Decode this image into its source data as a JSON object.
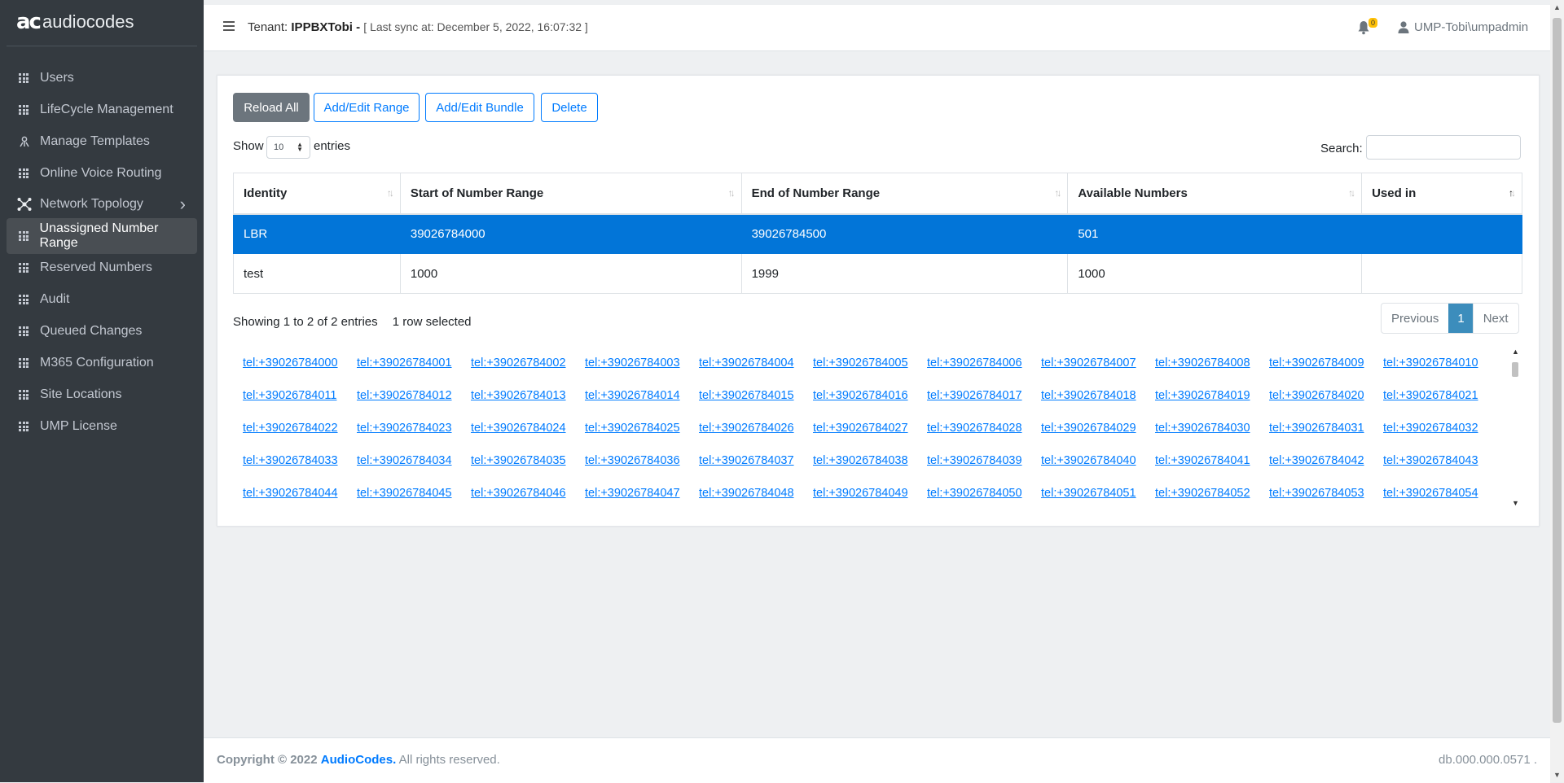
{
  "app": {
    "logo_mark": "ac",
    "logo_text": "audiocodes"
  },
  "sidebar": {
    "items": [
      {
        "label": "Users",
        "icon": "grid-icon"
      },
      {
        "label": "LifeCycle Management",
        "icon": "grid-icon"
      },
      {
        "label": "Manage Templates",
        "icon": "templates-icon"
      },
      {
        "label": "Online Voice Routing",
        "icon": "grid-icon"
      },
      {
        "label": "Network Topology",
        "icon": "network-icon"
      },
      {
        "label": "Unassigned Number Range",
        "icon": "grid-icon",
        "active": true
      },
      {
        "label": "Reserved Numbers",
        "icon": "grid-icon"
      },
      {
        "label": "Audit",
        "icon": "grid-icon"
      },
      {
        "label": "Queued Changes",
        "icon": "grid-icon"
      },
      {
        "label": "M365 Configuration",
        "icon": "grid-icon"
      },
      {
        "label": "Site Locations",
        "icon": "grid-icon"
      },
      {
        "label": "UMP License",
        "icon": "grid-icon"
      }
    ]
  },
  "header": {
    "tenant_prefix": "Tenant:",
    "tenant_name": "IPPBXTobi -",
    "sync": "[ Last sync at: December 5, 2022, 16:07:32 ]",
    "notification_count": "0",
    "user": "UMP-Tobi\\umpadmin"
  },
  "toolbar": {
    "reload_all": "Reload All",
    "add_edit_range": "Add/Edit Range",
    "add_edit_bundle": "Add/Edit Bundle",
    "delete": "Delete"
  },
  "table_controls": {
    "show": "Show",
    "page_length": "10",
    "entries": "entries",
    "search_label": "Search:",
    "search_value": ""
  },
  "table": {
    "columns": [
      "Identity",
      "Start of Number Range",
      "End of Number Range",
      "Available Numbers",
      "Used in"
    ],
    "rows": [
      {
        "identity": "LBR",
        "start": "39026784000",
        "end": "39026784500",
        "available": "501",
        "used_in": "",
        "selected": true
      },
      {
        "identity": "test",
        "start": "1000",
        "end": "1999",
        "available": "1000",
        "used_in": "",
        "selected": false
      }
    ],
    "info": "Showing 1 to 2 of 2 entries",
    "selection_info": "1 row selected"
  },
  "pagination": {
    "previous": "Previous",
    "current": "1",
    "next": "Next"
  },
  "numbers": [
    "tel:+39026784000",
    "tel:+39026784001",
    "tel:+39026784002",
    "tel:+39026784003",
    "tel:+39026784004",
    "tel:+39026784005",
    "tel:+39026784006",
    "tel:+39026784007",
    "tel:+39026784008",
    "tel:+39026784009",
    "tel:+39026784010",
    "tel:+39026784011",
    "tel:+39026784012",
    "tel:+39026784013",
    "tel:+39026784014",
    "tel:+39026784015",
    "tel:+39026784016",
    "tel:+39026784017",
    "tel:+39026784018",
    "tel:+39026784019",
    "tel:+39026784020",
    "tel:+39026784021",
    "tel:+39026784022",
    "tel:+39026784023",
    "tel:+39026784024",
    "tel:+39026784025",
    "tel:+39026784026",
    "tel:+39026784027",
    "tel:+39026784028",
    "tel:+39026784029",
    "tel:+39026784030",
    "tel:+39026784031",
    "tel:+39026784032",
    "tel:+39026784033",
    "tel:+39026784034",
    "tel:+39026784035",
    "tel:+39026784036",
    "tel:+39026784037",
    "tel:+39026784038",
    "tel:+39026784039",
    "tel:+39026784040",
    "tel:+39026784041",
    "tel:+39026784042",
    "tel:+39026784043",
    "tel:+39026784044",
    "tel:+39026784045",
    "tel:+39026784046",
    "tel:+39026784047",
    "tel:+39026784048",
    "tel:+39026784049",
    "tel:+39026784050",
    "tel:+39026784051",
    "tel:+39026784052",
    "tel:+39026784053",
    "tel:+39026784054"
  ],
  "footer": {
    "copyright": "Copyright © 2022",
    "brand": "AudioCodes.",
    "rights": "All rights reserved.",
    "version": "db.000.000.0571 ."
  },
  "colors": {
    "sidebar_bg": "#343a40",
    "accent": "#007bff",
    "selected_row": "#0275d8",
    "badge": "#ffc107"
  }
}
